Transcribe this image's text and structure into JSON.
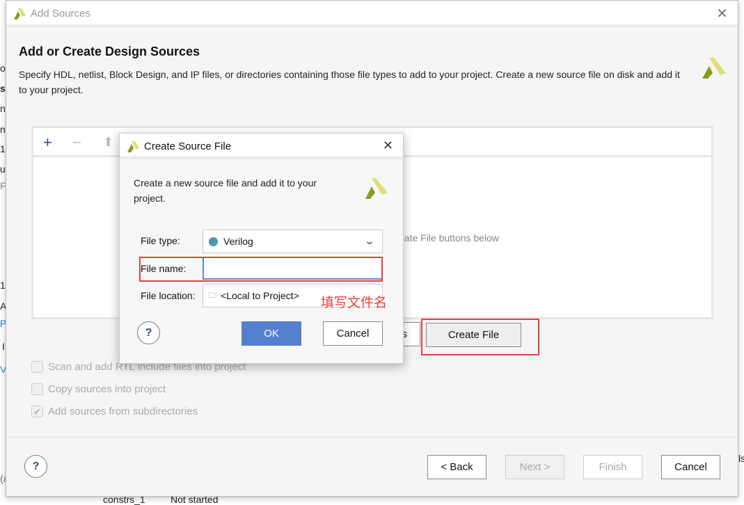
{
  "background": {
    "left_fragments": [
      "o",
      "s",
      "nt",
      "n",
      "1",
      "ur",
      "F",
      "1",
      "A",
      "P",
      "I",
      "V",
      "(a"
    ],
    "bottom_cells": [
      "constrs_1",
      "Not started"
    ],
    "right_fragment": "ls"
  },
  "wizard": {
    "title": "Add Sources",
    "heading": "Add or Create Design Sources",
    "description": "Specify HDL, netlist, Block Design, and IP files, or directories containing those file types to add to your project. Create a new source file on disk and add it to your project.",
    "hint_text": "eate File buttons below",
    "partial_button_label": "s",
    "create_file_label": "Create File",
    "options": [
      {
        "label": "Scan and add RTL include files into project",
        "checked": false
      },
      {
        "label": "Copy sources into project",
        "checked": false
      },
      {
        "label": "Add sources from subdirectories",
        "checked": true
      }
    ],
    "help": "?",
    "back": "< Back",
    "next": "Next >",
    "finish": "Finish",
    "cancel": "Cancel"
  },
  "dialog": {
    "title": "Create Source File",
    "description": "Create a new source file and add it to your project.",
    "file_type_label": "File type:",
    "file_type_value": "Verilog",
    "file_type_dot_color": "#4a98ab",
    "file_name_label": "File name:",
    "file_name_value": "",
    "file_location_label": "File location:",
    "file_location_value": "<Local to Project>",
    "help": "?",
    "ok": "OK",
    "cancel": "Cancel"
  },
  "annotation": {
    "text": "填写文件名",
    "color": "#f03c3c"
  },
  "colors": {
    "accent": "#5580d0",
    "highlight": "#f03c3c",
    "logo_dark": "#8c9a1e",
    "logo_light": "#d9e07a"
  }
}
